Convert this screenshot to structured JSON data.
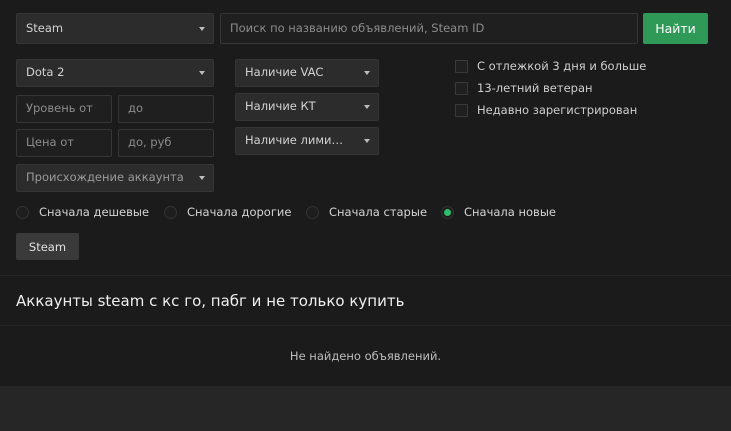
{
  "search": {
    "platform_select": "Steam",
    "query_placeholder": "Поиск по названию объявлений, Steam ID",
    "submit_label": "Найти"
  },
  "filters": {
    "game_select": "Dota 2",
    "level_from_placeholder": "Уровень от",
    "level_to_placeholder": "до",
    "price_from_placeholder": "Цена от",
    "price_to_placeholder": "до, руб",
    "origin_select": "Происхождение аккаунта",
    "vac_select": "Наличие VAC",
    "kt_select": "Наличие КТ",
    "limit_select": "Наличие лими…",
    "checkboxes": [
      {
        "label": "С отлежкой 3 дня и больше",
        "checked": false
      },
      {
        "label": "13-летний ветеран",
        "checked": false
      },
      {
        "label": "Недавно зарегистрирован",
        "checked": false
      }
    ]
  },
  "sort": {
    "options": [
      {
        "label": "Сначала дешевые",
        "selected": false
      },
      {
        "label": "Сначала дорогие",
        "selected": false
      },
      {
        "label": "Сначала старые",
        "selected": false
      },
      {
        "label": "Сначала новые",
        "selected": true
      }
    ]
  },
  "tag_button": "Steam",
  "section_title": "Аккаунты steam с кс го, пабг и не только купить",
  "empty_message": "Не найдено объявлений.",
  "colors": {
    "accent_green": "#2f9a57",
    "radio_selected": "#2bbf6b",
    "panel_bg": "#1b1b1b",
    "page_bg": "#262626"
  }
}
